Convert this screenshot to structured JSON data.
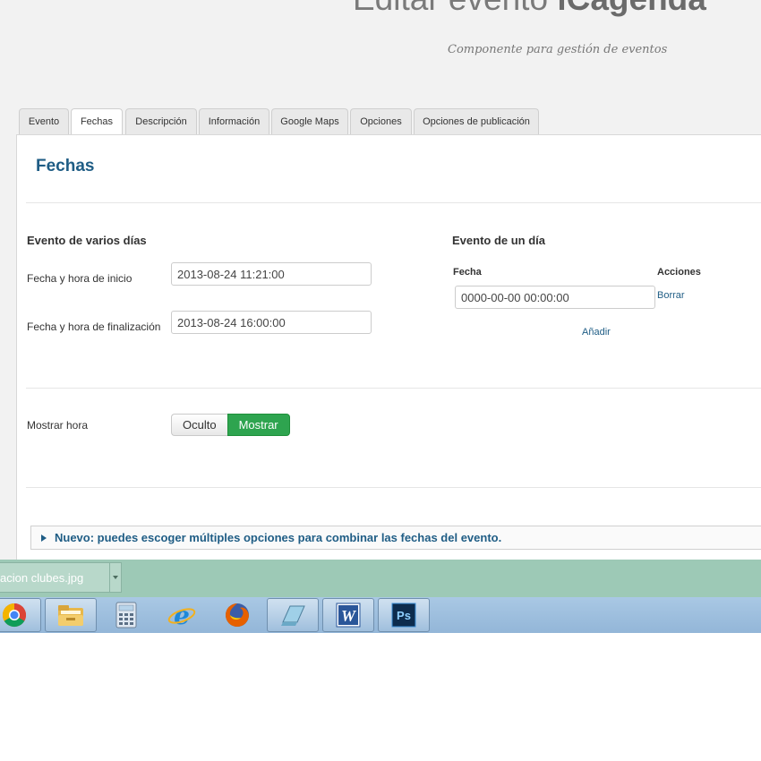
{
  "header": {
    "title_prefix": "Editar evento",
    "title_brand": "iCagenda",
    "subtitle": "Componente para gestión de eventos"
  },
  "tabs": [
    {
      "label": "Evento",
      "active": false
    },
    {
      "label": "Fechas",
      "active": true
    },
    {
      "label": "Descripción",
      "active": false
    },
    {
      "label": "Información",
      "active": false
    },
    {
      "label": "Google Maps",
      "active": false
    },
    {
      "label": "Opciones",
      "active": false
    },
    {
      "label": "Opciones de publicación",
      "active": false
    }
  ],
  "section_title": "Fechas",
  "multi_day": {
    "heading": "Evento de varios días",
    "start_label": "Fecha y hora de inicio",
    "start_value": "2013-08-24 11:21:00",
    "end_label": "Fecha y hora de finalización",
    "end_value": "2013-08-24 16:00:00"
  },
  "single_day": {
    "heading": "Evento de un día",
    "col_date": "Fecha",
    "col_actions": "Acciones",
    "date_value": "0000-00-00 00:00:00",
    "delete_link": "Borrar",
    "add_link": "Añadir"
  },
  "show_time": {
    "label": "Mostrar hora",
    "option_hidden": "Oculto",
    "option_show": "Mostrar",
    "selected": "Mostrar"
  },
  "notice": "Nuevo: puedes escoger múltiples opciones para combinar las fechas del evento.",
  "download_bar": {
    "filename": "acion clubes.jpg"
  },
  "taskbar": {
    "icons": [
      "chrome-icon",
      "file-explorer-icon",
      "calculator-icon",
      "internet-explorer-icon",
      "firefox-icon",
      "notepad-icon",
      "word-icon",
      "photoshop-icon"
    ]
  },
  "colors": {
    "accent": "#1f5d85",
    "toggle_on": "#2ea44f",
    "download_bar": "#9dc9b6",
    "taskbar": "#a9c8e4"
  }
}
